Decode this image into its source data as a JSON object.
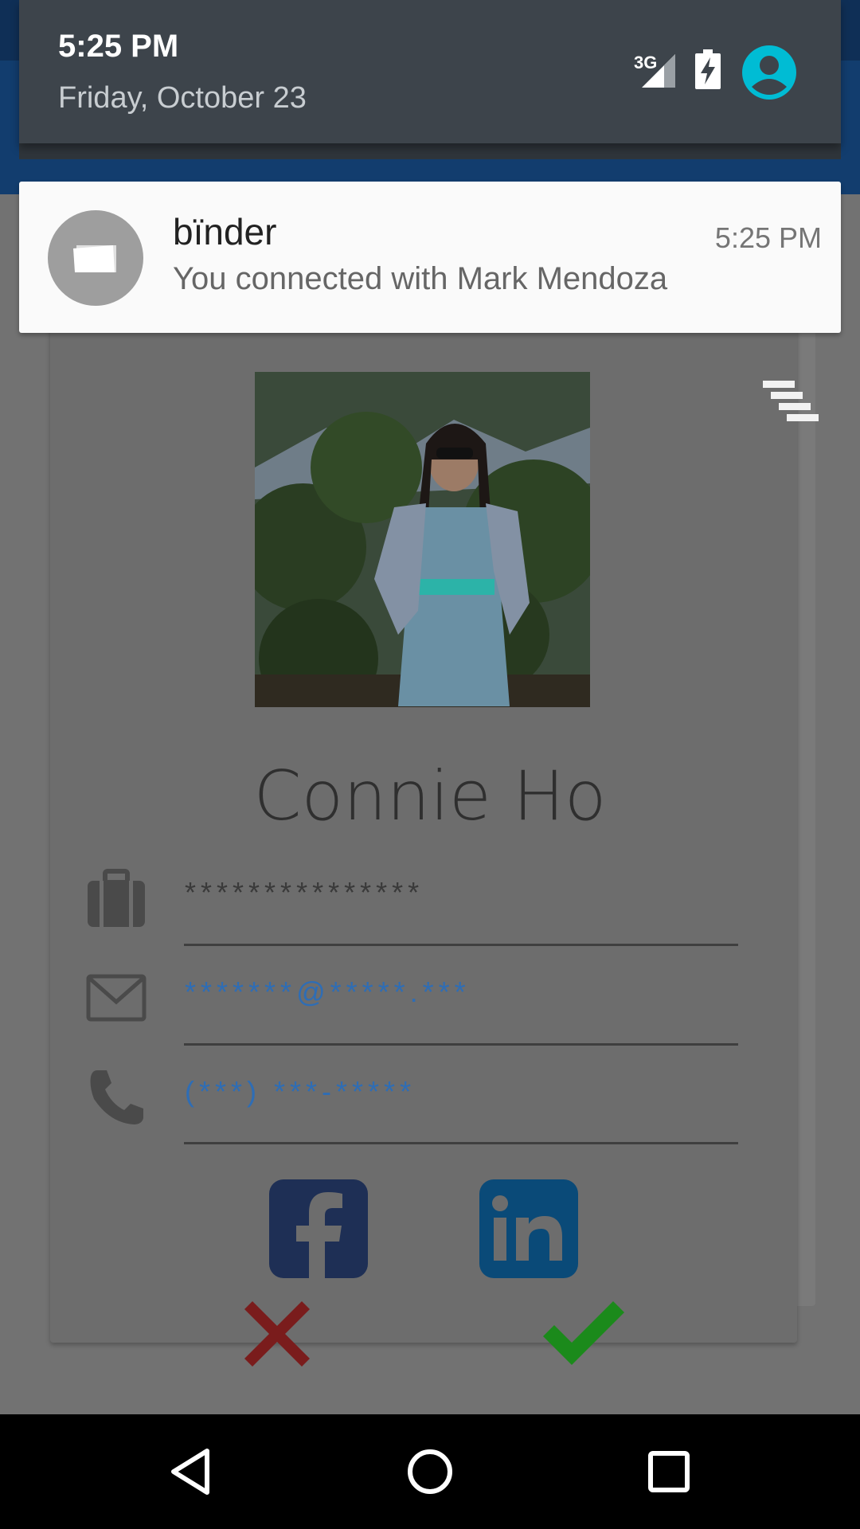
{
  "status_shade": {
    "time": "5:25 PM",
    "date": "Friday, October 23",
    "network_label": "3G",
    "icons": [
      "signal-icon",
      "battery-charging-icon",
      "account-icon"
    ]
  },
  "notification": {
    "app_name": "bïnder",
    "message": "You connected with Mark Mendoza",
    "time": "5:25 PM",
    "icon": "cards-icon"
  },
  "profile_card": {
    "name": "Connie Ho",
    "fields": [
      {
        "icon": "briefcase-icon",
        "value": "***************"
      },
      {
        "icon": "email-icon",
        "value": "*******@*****.***"
      },
      {
        "icon": "phone-icon",
        "value": "(***) ***-*****"
      }
    ],
    "social": [
      "facebook-icon",
      "linkedin-icon"
    ],
    "actions": [
      "reject-icon",
      "accept-icon"
    ]
  },
  "nav_bar": [
    "back-icon",
    "home-icon",
    "recents-icon"
  ],
  "colors": {
    "accent_teal": "#00bcd4",
    "field_blue": "#2e6db5",
    "reject_red": "#7a1c1c",
    "accept_green": "#1b8a1b",
    "facebook_blue": "#1e2f55",
    "linkedin_blue": "#0a4a78"
  }
}
